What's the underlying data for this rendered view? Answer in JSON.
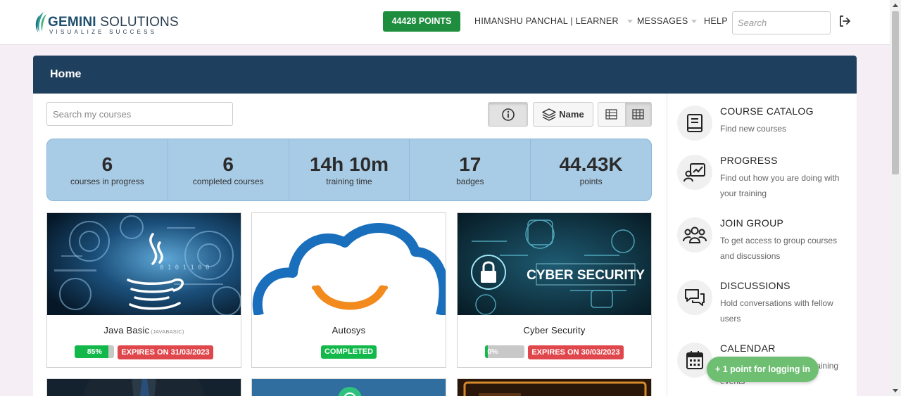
{
  "header": {
    "logo_brand": "GEMINI",
    "logo_suffix": " SOLUTIONS",
    "logo_tagline": "VISUALIZE SUCCESS",
    "points_label": "44428 POINTS",
    "user_name": "HIMANSHU PANCHAL",
    "user_separator": " | ",
    "user_role": "LEARNER",
    "messages_label": "MESSAGES",
    "help_label": "HELP",
    "search_placeholder": "Search"
  },
  "panel": {
    "title": "Home",
    "course_search_placeholder": "Search my courses",
    "sort_label": "Name"
  },
  "stats": [
    {
      "value": "6",
      "label": "courses in progress"
    },
    {
      "value": "6",
      "label": "completed courses"
    },
    {
      "value": "14h 10m",
      "label": "training time"
    },
    {
      "value": "17",
      "label": "badges"
    },
    {
      "value": "44.43K",
      "label": "points"
    }
  ],
  "courses": [
    {
      "title": "Java Basic",
      "code": "(JAVABASIC)",
      "progress_label": "85%",
      "progress_fraction": 0.85,
      "expires": "EXPIRES ON 31/03/2023"
    },
    {
      "title": "Autosys",
      "status": "COMPLETED"
    },
    {
      "title": "Cyber Security",
      "progress_label": "0%",
      "progress_fraction": 0.0,
      "expires": "EXPIRES ON 30/03/2023",
      "image_text": "CYBER SECURITY"
    }
  ],
  "sidebar": {
    "items": [
      {
        "title": "COURSE CATALOG",
        "desc": "Find new courses"
      },
      {
        "title": "PROGRESS",
        "desc": "Find out how you are doing with your training"
      },
      {
        "title": "JOIN GROUP",
        "desc": "To get access to group courses and discussions"
      },
      {
        "title": "DISCUSSIONS",
        "desc": "Hold conversations with fellow users"
      },
      {
        "title": "CALENDAR",
        "desc": "Find out your upcoming training events"
      }
    ]
  },
  "toast": {
    "text": "+ 1 point for logging in"
  },
  "colors": {
    "header_bg": "#1f3f5e",
    "points_green": "#1e8e3e",
    "stats_bg": "#a9cce6",
    "progress_green": "#12b84a",
    "expires_red": "#e0474c",
    "toast_green": "#6fbf73"
  }
}
